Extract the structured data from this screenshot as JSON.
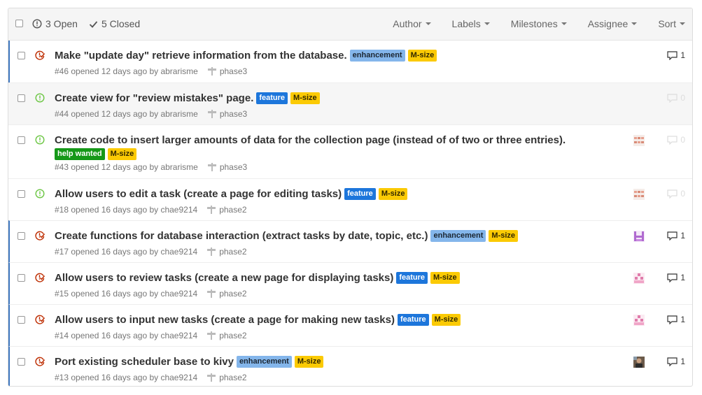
{
  "header": {
    "open_label": "3 Open",
    "closed_label": "5 Closed",
    "filters": [
      "Author",
      "Labels",
      "Milestones",
      "Assignee",
      "Sort"
    ]
  },
  "issues": [
    {
      "title": "Make \"update day\" retrieve information from the database.",
      "state": "closed",
      "labels": [
        "enhancement",
        "M-size"
      ],
      "meta": "#46 opened 12 days ago by abrarisme",
      "milestone": "phase3",
      "comments": "1",
      "avatar": false
    },
    {
      "title": "Create view for \"review mistakes\" page.",
      "state": "open",
      "labels": [
        "feature",
        "M-size"
      ],
      "meta": "#44 opened 12 days ago by abrarisme",
      "milestone": "phase3",
      "comments": "0",
      "avatar": false
    },
    {
      "title": "Create code to insert larger amounts of data for the collection page (instead of of two or three entries).",
      "state": "open",
      "labels": [
        "help wanted",
        "M-size"
      ],
      "meta": "#43 opened 12 days ago by abrarisme",
      "milestone": "phase3",
      "comments": "0",
      "avatar": true
    },
    {
      "title": "Allow users to edit a task (create a page for editing tasks)",
      "state": "open",
      "labels": [
        "feature",
        "M-size"
      ],
      "meta": "#18 opened 16 days ago by chae9214",
      "milestone": "phase2",
      "comments": "0",
      "avatar": true
    },
    {
      "title": "Create functions for database interaction (extract tasks by date, topic, etc.)",
      "state": "closed",
      "labels": [
        "enhancement",
        "M-size"
      ],
      "meta": "#17 opened 16 days ago by chae9214",
      "milestone": "phase2",
      "comments": "1",
      "avatar": true
    },
    {
      "title": "Allow users to review tasks (create a new page for displaying tasks)",
      "state": "closed",
      "labels": [
        "feature",
        "M-size"
      ],
      "meta": "#15 opened 16 days ago by chae9214",
      "milestone": "phase2",
      "comments": "1",
      "avatar": true
    },
    {
      "title": "Allow users to input new tasks (create a page for making new tasks)",
      "state": "closed",
      "labels": [
        "feature",
        "M-size"
      ],
      "meta": "#14 opened 16 days ago by chae9214",
      "milestone": "phase2",
      "comments": "1",
      "avatar": true
    },
    {
      "title": "Port existing scheduler base to kivy",
      "state": "closed",
      "labels": [
        "enhancement",
        "M-size"
      ],
      "meta": "#13 opened 16 days ago by chae9214",
      "milestone": "phase2",
      "comments": "1",
      "avatar": true
    }
  ],
  "colors": {
    "open_icon": "#6cc644",
    "closed_icon": "#bd2c00",
    "enhancement": "#84b6eb",
    "feature": "#1d76db",
    "m_size": "#fbca04",
    "help_wanted": "#159818"
  }
}
